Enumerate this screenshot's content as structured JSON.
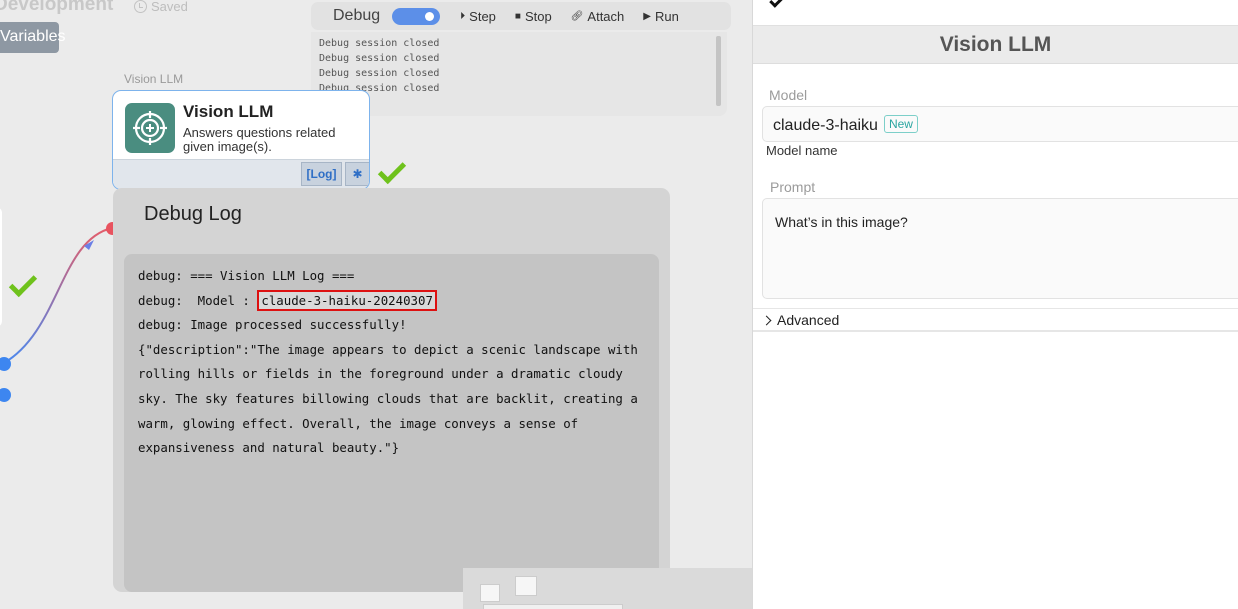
{
  "canvas": {
    "project_title": "Development",
    "saved_label": "Saved",
    "variables_label": "Variables"
  },
  "debug_bar": {
    "label": "Debug",
    "toggle_on": true,
    "step_label": "Step",
    "stop_label": "Stop",
    "attach_label": "Attach",
    "run_label": "Run"
  },
  "console_lines": [
    "Debug session closed",
    "Debug session closed",
    "Debug session closed",
    "Debug session closed"
  ],
  "node": {
    "caption": "Vision LLM",
    "title": "Vision LLM",
    "description": "Answers questions related given image(s).",
    "log_button": "[Log]",
    "status": "success",
    "accent_color": "#7db3ec",
    "icon_color": "#4a8d80"
  },
  "debug_log": {
    "title": "Debug Log",
    "lines": [
      "debug: === Vision LLM Log ===",
      "debug:  Model : ",
      "debug: Image processed successfully!",
      "{\"description\":\"The image appears to depict a scenic landscape with",
      "rolling hills or fields in the foreground under a dramatic cloudy",
      "sky. The sky features billowing clouds that are backlit, creating a",
      "warm, glowing effect. Overall, the image conveys a sense of",
      "expansiveness and natural beauty.\"}"
    ],
    "highlighted_model": "claude-3-haiku-20240307"
  },
  "panel": {
    "title": "Vision LLM",
    "model_label": "Model",
    "model_value": "claude-3-haiku",
    "model_badge": "New",
    "model_sublabel": "Model name",
    "prompt_label": "Prompt",
    "prompt_value": "What’s in this image?",
    "advanced_label": "Advanced"
  }
}
